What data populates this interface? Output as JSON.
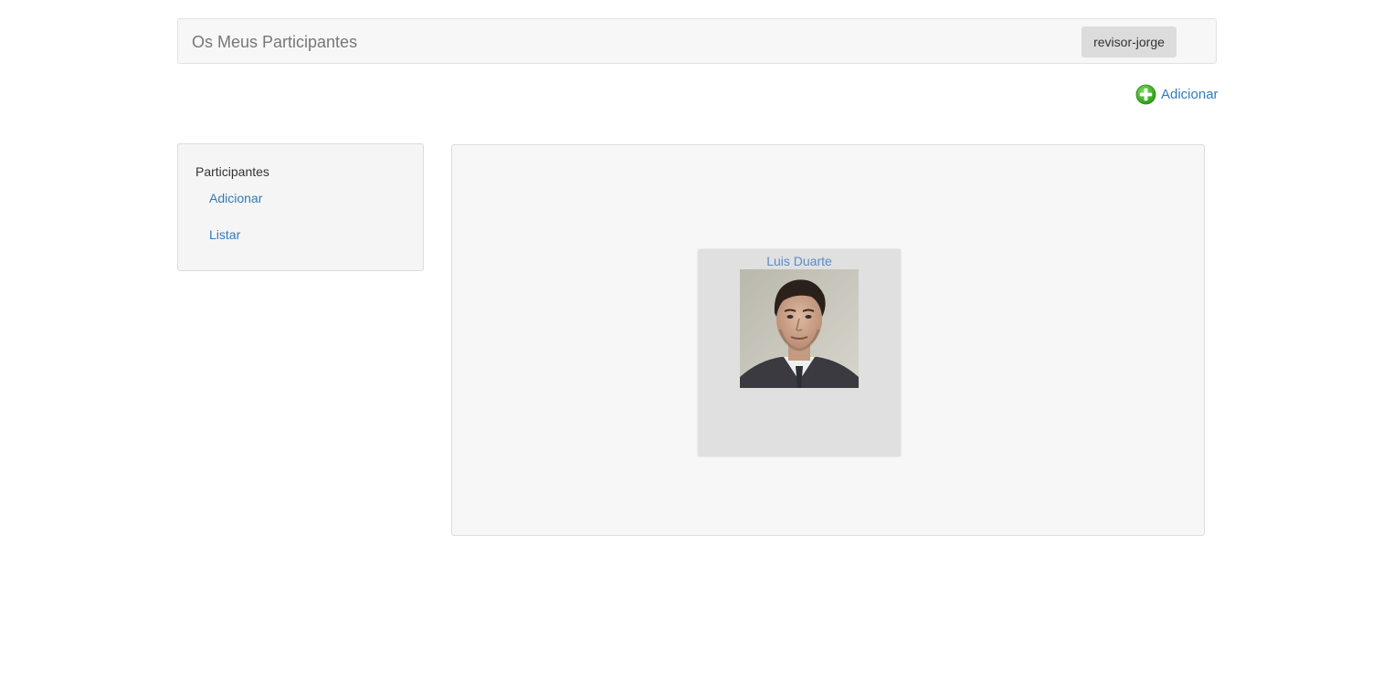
{
  "navbar": {
    "brand": "Os Meus Participantes",
    "user": "revisor-jorge"
  },
  "toolbar": {
    "add_label": "Adicionar",
    "add_icon": "plus-circle-icon"
  },
  "sidebar": {
    "heading": "Participantes",
    "items": [
      {
        "label": "Adicionar"
      },
      {
        "label": "Listar"
      }
    ]
  },
  "participants": [
    {
      "name": "Luis Duarte",
      "photo": "portrait-photo"
    }
  ],
  "colors": {
    "link": "#337ab7",
    "navbar_bg": "#f7f7f7",
    "card_bg": "#e0e0e0",
    "add_icon_green": "#3cb521"
  }
}
